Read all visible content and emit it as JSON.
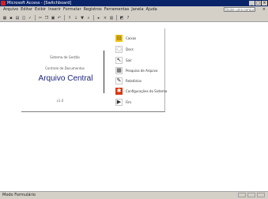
{
  "window": {
    "title": "Microsoft Access - [Switchboard]",
    "controls": [
      "_",
      "□",
      "×"
    ]
  },
  "menubar": {
    "items": [
      "Arquivo",
      "Editar",
      "Exibir",
      "Inserir",
      "Formatar",
      "Registros",
      "Ferramentas",
      "Janela",
      "Ajuda"
    ],
    "help_placeholder": "Digite uma pergunta",
    "close_label": "× "
  },
  "toolbar": {
    "buttons": [
      {
        "name": "view-icon",
        "glyph": "▦"
      },
      {
        "name": "save-icon",
        "glyph": "▪"
      },
      {
        "name": "print-icon",
        "glyph": "▤"
      },
      {
        "name": "preview-icon",
        "glyph": "◫"
      },
      {
        "name": "spell-icon",
        "glyph": "✓"
      },
      {
        "name": "cut-icon",
        "glyph": "✂"
      },
      {
        "name": "copy-icon",
        "glyph": "❐"
      },
      {
        "name": "paste-icon",
        "glyph": "▣"
      },
      {
        "name": "undo-icon",
        "glyph": "↶"
      },
      {
        "name": "sort-asc-icon",
        "glyph": "↑"
      },
      {
        "name": "sort-desc-icon",
        "glyph": "↓"
      },
      {
        "name": "filter-icon",
        "glyph": "▼"
      },
      {
        "name": "find-icon",
        "glyph": "⌕"
      },
      {
        "name": "new-record-icon",
        "glyph": "▸"
      },
      {
        "name": "delete-record-icon",
        "glyph": "×"
      },
      {
        "name": "database-icon",
        "glyph": "▥"
      },
      {
        "name": "new-object-icon",
        "glyph": "◩"
      },
      {
        "name": "help-icon",
        "glyph": "?"
      }
    ]
  },
  "switchboard": {
    "subtitle1": "Sistema de Gestão",
    "subtitle2": "Controle de Documentos",
    "title": "Arquivo Central",
    "version": "v1.0",
    "items": [
      {
        "label": "Caixas",
        "icon": "box-icon",
        "glyph": "▤",
        "bg": "#f0c419",
        "fg": "#7a5a00"
      },
      {
        "label": "Docs",
        "icon": "document-icon",
        "glyph": "◌",
        "bg": "#ffffff",
        "fg": "#555555"
      },
      {
        "label": "Sair",
        "icon": "arrow-icon",
        "glyph": "↖",
        "bg": "#ffffff",
        "fg": "#111111"
      },
      {
        "label": "Pesquisa de Arquivo",
        "icon": "search-records-icon",
        "glyph": "▦",
        "bg": "#ffffff",
        "fg": "#333333"
      },
      {
        "label": "Relatórios",
        "icon": "report-icon",
        "glyph": "✎",
        "bg": "#ffffff",
        "fg": "#222222"
      },
      {
        "label": "Configurações do Sistema",
        "icon": "settings-icon",
        "glyph": "✱",
        "bg": "#d93a12",
        "fg": "#ffffff"
      },
      {
        "label": "Fim",
        "icon": "exit-icon",
        "glyph": "▶",
        "bg": "#ffffff",
        "fg": "#333333"
      }
    ]
  },
  "status": {
    "text": "Modo Formulário"
  }
}
